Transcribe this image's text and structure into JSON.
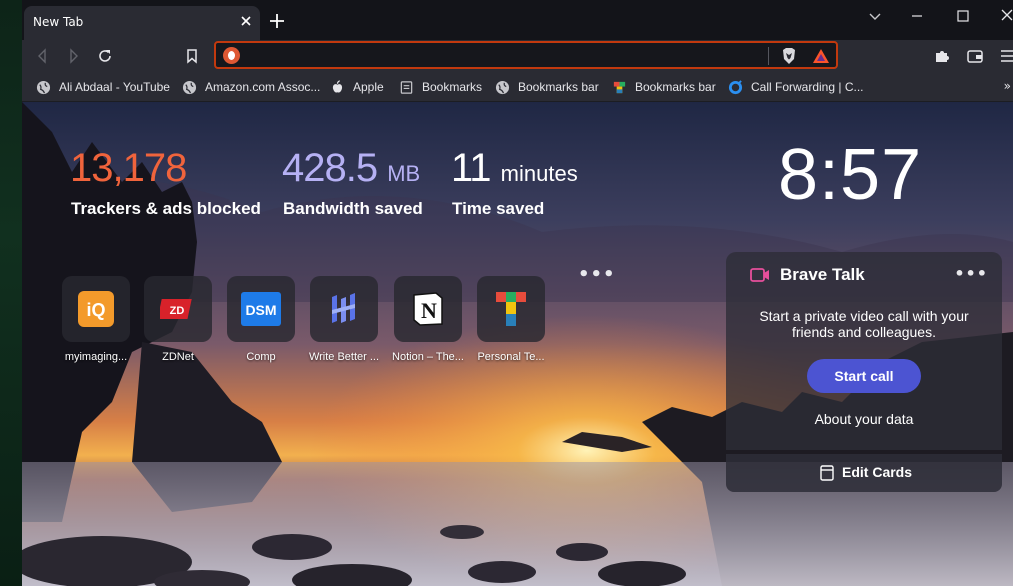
{
  "tab": {
    "title": "New Tab"
  },
  "urlbar": {
    "value": "",
    "placeholder": ""
  },
  "bookmarks": [
    {
      "label": "Ali Abdaal - YouTube",
      "icon": "globe-icon"
    },
    {
      "label": "Amazon.com Assoc...",
      "icon": "globe-icon"
    },
    {
      "label": "Apple",
      "icon": "apple-icon"
    },
    {
      "label": "Bookmarks",
      "icon": "page-icon"
    },
    {
      "label": "Bookmarks bar",
      "icon": "globe-icon"
    },
    {
      "label": "Bookmarks bar",
      "icon": "color-grid-icon"
    },
    {
      "label": "Call Forwarding | C...",
      "icon": "ring-icon"
    }
  ],
  "bookmarks_more": "»",
  "stats": {
    "trackers": {
      "value": "13,178",
      "label": "Trackers & ads blocked",
      "color": "#f0643c"
    },
    "bandwidth": {
      "value": "428.5",
      "unit": "MB",
      "label": "Bandwidth saved",
      "color": "#b6b1f4"
    },
    "time": {
      "value": "11",
      "unit": "minutes",
      "label": "Time saved",
      "color": "#ffffff"
    }
  },
  "clock": "8:57",
  "top_sites": [
    {
      "label": "myimaging...",
      "icon": "iq-icon"
    },
    {
      "label": "ZDNet",
      "icon": "zdnet-icon"
    },
    {
      "label": "Comp",
      "icon": "dsm-icon"
    },
    {
      "label": "Write Better ...",
      "icon": "write-better-icon"
    },
    {
      "label": "Notion – The...",
      "icon": "notion-icon"
    },
    {
      "label": "Personal Te...",
      "icon": "personal-te-icon"
    }
  ],
  "top_sites_menu": "•••",
  "brave_talk": {
    "title": "Brave Talk",
    "menu": "•••",
    "description": "Start a private video call with your friends and colleagues.",
    "button": "Start call",
    "about": "About your data",
    "accent": "#4c54d2"
  },
  "edit_cards": "Edit Cards",
  "colors": {
    "accent": "#c2390e",
    "tracker": "#f0643c",
    "bandwidth": "#b6b1f4"
  }
}
